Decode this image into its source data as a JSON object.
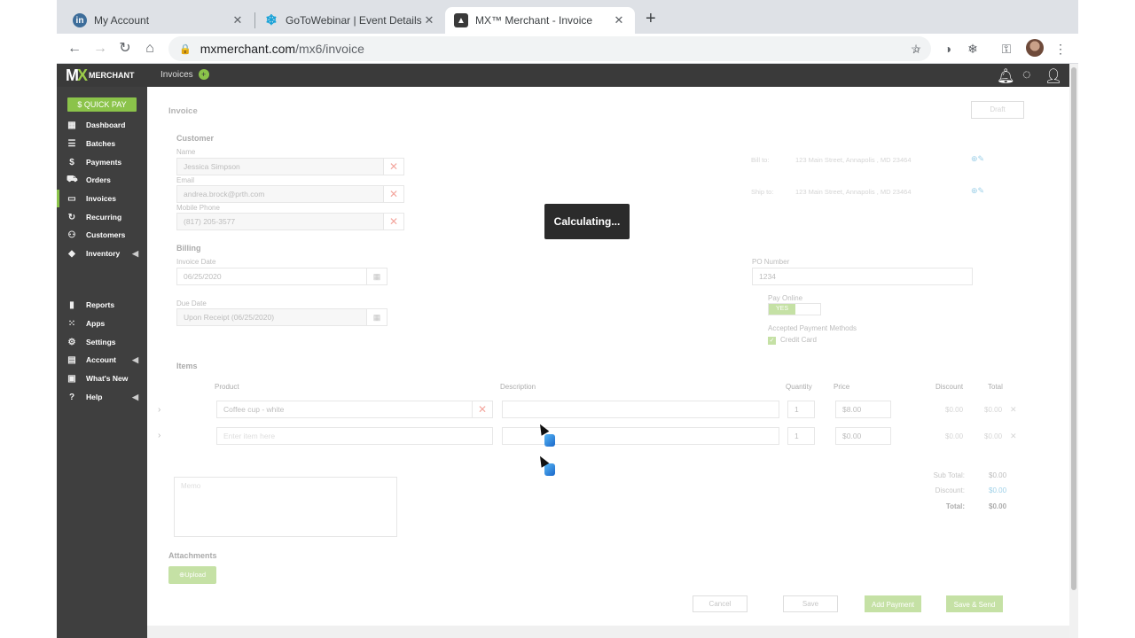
{
  "browser": {
    "tabs": [
      {
        "title": "My Account",
        "icon": "linkedin-icon"
      },
      {
        "title": "GoToWebinar | Event Details",
        "icon": "snowflake-icon"
      },
      {
        "title": "MX™ Merchant - Invoice",
        "icon": "mx-icon"
      }
    ],
    "url_domain": "mxmerchant.com",
    "url_path": "/mx6/invoice"
  },
  "header": {
    "logo_text": "MERCHANT",
    "title": "Invoices"
  },
  "sidebar": {
    "quick_pay": "$ QUICK PAY",
    "items": [
      {
        "label": "Dashboard",
        "icon": "dashboard-icon"
      },
      {
        "label": "Batches",
        "icon": "list-icon"
      },
      {
        "label": "Payments",
        "icon": "dollar-icon"
      },
      {
        "label": "Orders",
        "icon": "cart-icon"
      },
      {
        "label": "Invoices",
        "icon": "clipboard-icon"
      },
      {
        "label": "Recurring",
        "icon": "refresh-icon"
      },
      {
        "label": "Customers",
        "icon": "users-icon"
      },
      {
        "label": "Inventory",
        "icon": "tag-icon"
      },
      {
        "label": "Reports",
        "icon": "bar-chart-icon"
      },
      {
        "label": "Apps",
        "icon": "grid-icon"
      },
      {
        "label": "Settings",
        "icon": "gear-icon"
      },
      {
        "label": "Account",
        "icon": "account-icon"
      },
      {
        "label": "What's New",
        "icon": "news-icon"
      },
      {
        "label": "Help",
        "icon": "help-icon"
      }
    ]
  },
  "invoice": {
    "title": "Invoice",
    "status": "Draft",
    "customer_section": "Customer",
    "name_label": "Name",
    "name_value": "Jessica Simpson",
    "email_label": "Email",
    "email_value": "andrea.brock@prth.com",
    "phone_label": "Mobile Phone",
    "phone_value": "(817) 205-3577",
    "bill_to_label": "Bill to:",
    "bill_to_value": "123 Main Street, Annapolis , MD 23464",
    "ship_to_label": "Ship to:",
    "ship_to_value": "123 Main Street, Annapolis , MD 23464",
    "billing_section": "Billing",
    "invoice_date_label": "Invoice Date",
    "invoice_date_value": "06/25/2020",
    "due_date_label": "Due Date",
    "due_date_value": "Upon Receipt (06/25/2020)",
    "po_label": "PO Number",
    "po_value": "1234",
    "pay_online_label": "Pay Online",
    "pay_online_value": "YES",
    "accepted_label": "Accepted Payment Methods",
    "credit_card_label": "Credit Card",
    "items_section": "Items",
    "columns": {
      "product": "Product",
      "description": "Description",
      "quantity": "Quantity",
      "price": "Price",
      "discount": "Discount",
      "total": "Total"
    },
    "rows": [
      {
        "product": "Coffee cup - white",
        "quantity": "1",
        "price": "$8.00",
        "discount": "$0.00",
        "total": "$0.00"
      },
      {
        "product_placeholder": "Enter item here",
        "quantity": "1",
        "price": "$0.00",
        "discount": "$0.00",
        "total": "$0.00"
      }
    ],
    "memo_placeholder": "Memo",
    "subtotal_label": "Sub Total:",
    "subtotal_value": "$0.00",
    "discount_label": "Discount:",
    "discount_value": "$0.00",
    "total_label": "Total:",
    "total_value": "$0.00",
    "attachments_section": "Attachments",
    "upload_label": "Upload",
    "buttons": {
      "cancel": "Cancel",
      "save": "Save",
      "add_payment": "Add Payment",
      "save_send": "Save & Send"
    }
  },
  "overlay": {
    "text": "Calculating..."
  },
  "colors": {
    "accent": "#8bc34a",
    "header": "#3a3a3a",
    "sidebar": "#3f3f3f"
  }
}
